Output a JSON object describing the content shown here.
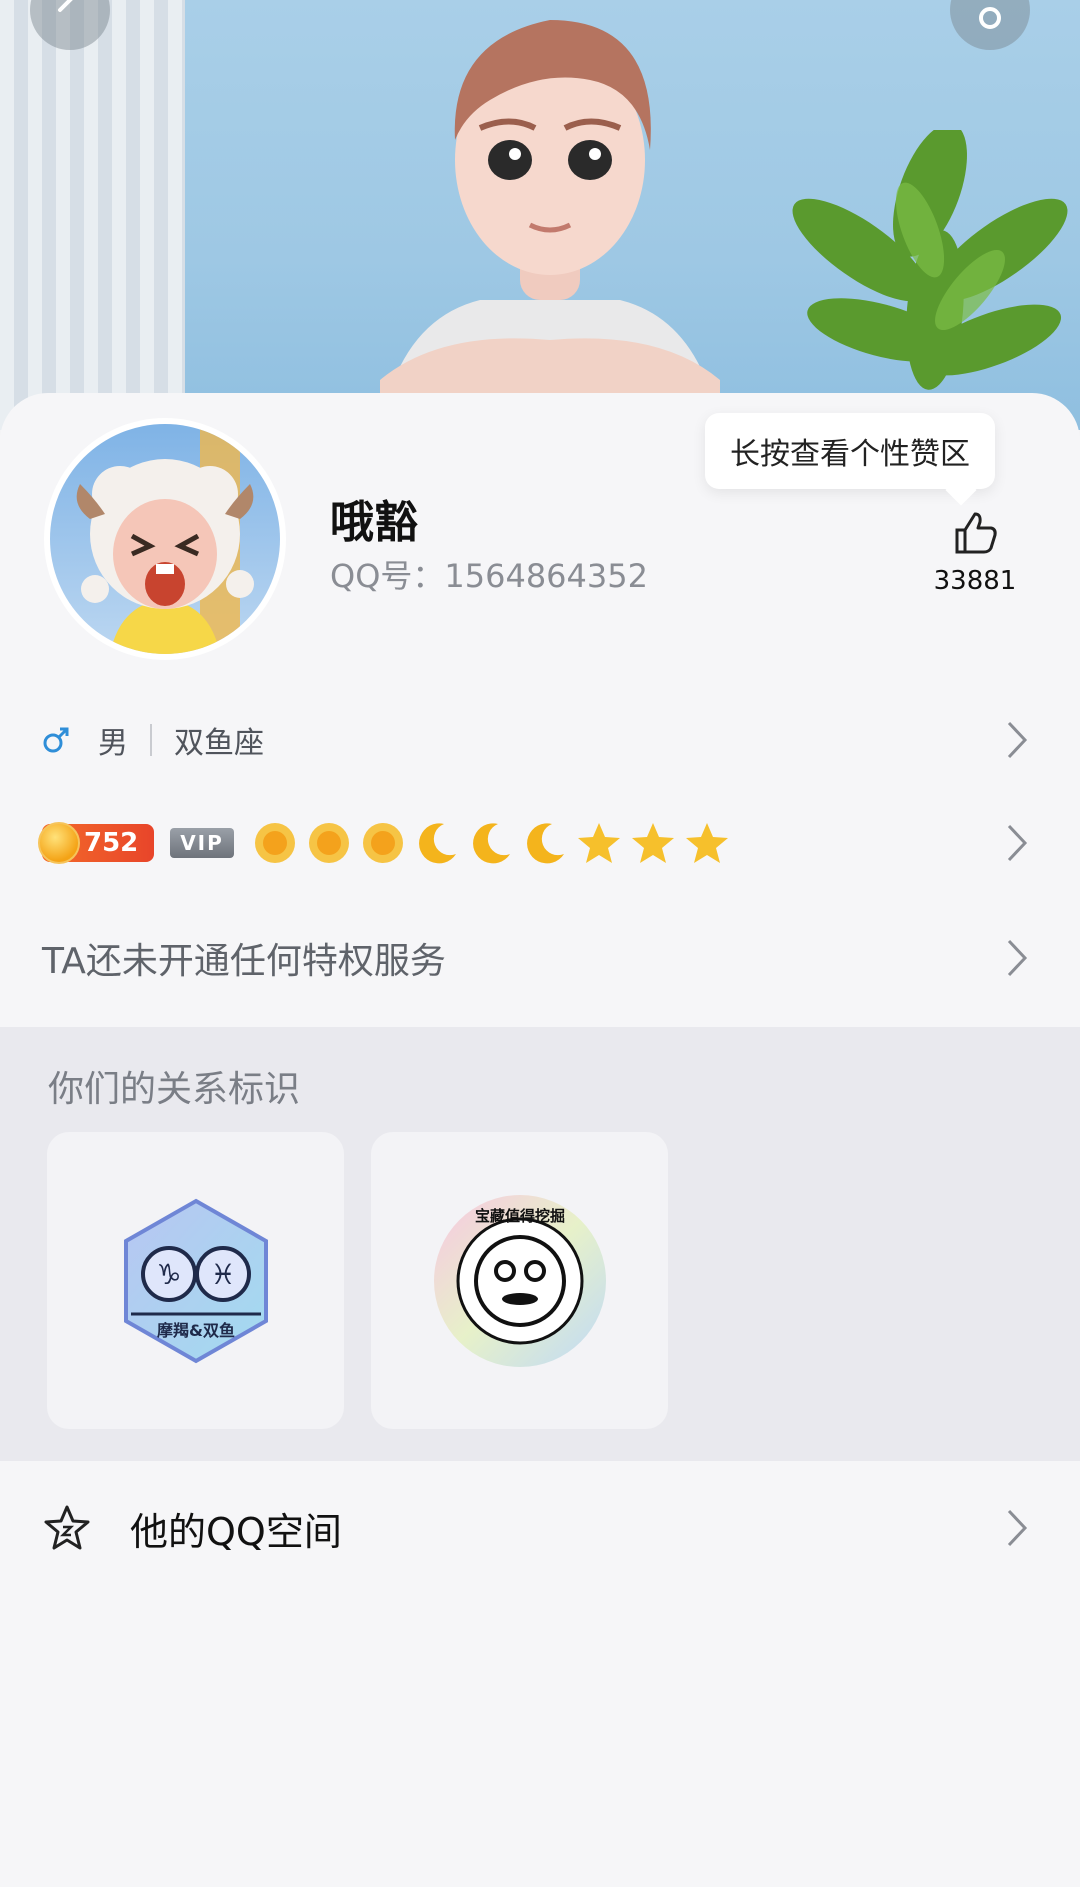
{
  "header": {
    "back_icon": "back-arrow-icon",
    "settings_icon": "gear-icon"
  },
  "profile": {
    "nickname": "哦豁",
    "qq_number": "QQ号：1564864352",
    "likes": {
      "tooltip": "长按查看个性赞区",
      "count": "33881",
      "icon": "thumbs-up-icon"
    }
  },
  "info": {
    "gender_icon": "male-icon",
    "gender": "男",
    "zodiac": "双鱼座"
  },
  "level": {
    "coins": "752",
    "vip_label": "VIP",
    "icons": [
      "sun",
      "sun",
      "sun",
      "moon",
      "moon",
      "moon",
      "star",
      "star",
      "star"
    ]
  },
  "privilege": {
    "text": "TA还未开通任何特权服务"
  },
  "relationship": {
    "title": "你们的关系标识",
    "badges": [
      {
        "label": "摩羯&双鱼",
        "icon": "capricorn-pisces-badge"
      },
      {
        "label": "宝藏值得挖掘",
        "icon": "treasure-face-badge"
      }
    ]
  },
  "qzone": {
    "label": "他的QQ空间",
    "icon": "star-outline-icon"
  },
  "colors": {
    "accent_blue": "#2f8ed8",
    "coin_red": "#e8452a",
    "gold": "#f4b41c"
  }
}
